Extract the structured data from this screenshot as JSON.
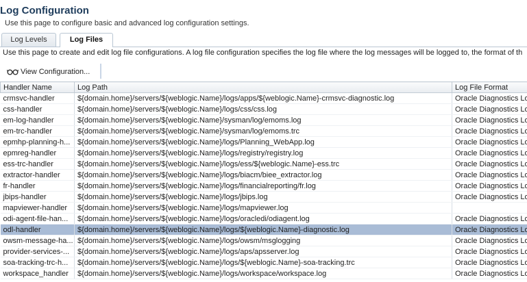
{
  "page": {
    "title": "Log Configuration",
    "subtitle": "Use this page to configure basic and advanced log configuration settings."
  },
  "tabs": [
    {
      "label": "Log Levels"
    },
    {
      "label": "Log Files"
    }
  ],
  "description": "Use this page to create and edit log file configurations. A log file configuration specifies the log file where the log messages will be logged to, the format of th",
  "toolbar": {
    "view_configuration": "View Configuration..."
  },
  "table": {
    "headers": [
      "Handler Name",
      "Log Path",
      "Log File Format"
    ],
    "rows": [
      [
        "crmsvc-handler",
        "${domain.home}/servers/${weblogic.Name}/logs/apps/${weblogic.Name}-crmsvc-diagnostic.log",
        "Oracle Diagnostics Log"
      ],
      [
        "css-handler",
        "${domain.home}/servers/${weblogic.Name}/logs/css/css.log",
        "Oracle Diagnostics Log"
      ],
      [
        "em-log-handler",
        "${domain.home}/servers/${weblogic.Name}/sysman/log/emoms.log",
        "Oracle Diagnostics Log"
      ],
      [
        "em-trc-handler",
        "${domain.home}/servers/${weblogic.Name}/sysman/log/emoms.trc",
        "Oracle Diagnostics Log"
      ],
      [
        "epmhp-planning-h...",
        "${domain.home}/servers/${weblogic.Name}/logs/Planning_WebApp.log",
        "Oracle Diagnostics Log"
      ],
      [
        "epmreg-handler",
        "${domain.home}/servers/${weblogic.Name}/logs/registry/registry.log",
        "Oracle Diagnostics Log"
      ],
      [
        "ess-trc-handler",
        "${domain.home}/servers/${weblogic.Name}/logs/ess/${weblogic.Name}-ess.trc",
        "Oracle Diagnostics Log"
      ],
      [
        "extractor-handler",
        "${domain.home}/servers/${weblogic.Name}/logs/biacm/biee_extractor.log",
        "Oracle Diagnostics Log"
      ],
      [
        "fr-handler",
        "${domain.home}/servers/${weblogic.Name}/logs/financialreporting/fr.log",
        "Oracle Diagnostics Log"
      ],
      [
        "jbips-handler",
        "${domain.home}/servers/${weblogic.Name}/logs/jbips.log",
        "Oracle Diagnostics Log"
      ],
      [
        "mapviewer-handler",
        "${domain.home}/servers/${weblogic.Name}/logs/mapviewer.log",
        ""
      ],
      [
        "odi-agent-file-han...",
        "${domain.home}/servers/${weblogic.Name}/logs/oracledi/odiagent.log",
        "Oracle Diagnostics Log"
      ],
      [
        "odl-handler",
        "${domain.home}/servers/${weblogic.Name}/logs/${weblogic.Name}-diagnostic.log",
        "Oracle Diagnostics Log"
      ],
      [
        "owsm-message-ha...",
        "${domain.home}/servers/${weblogic.Name}/logs/owsm/msglogging",
        "Oracle Diagnostics Log"
      ],
      [
        "provider-services-...",
        "${domain.home}/servers/${weblogic.Name}/logs/aps/apsserver.log",
        "Oracle Diagnostics Log"
      ],
      [
        "soa-tracking-trc-h...",
        "${domain.home}/servers/${weblogic.Name}/logs/${weblogic.Name}-soa-tracking.trc",
        "Oracle Diagnostics Log"
      ],
      [
        "workspace_handler",
        "${domain.home}/servers/${weblogic.Name}/logs/workspace/workspace.log",
        "Oracle Diagnostics Log"
      ]
    ],
    "selected_row": 12
  },
  "colors": {
    "title": "#1f3d5c",
    "selected_row": "#a9bcd6",
    "header_border": "#c2cbd4"
  },
  "icons": {
    "view_configuration": "glasses-icon"
  }
}
